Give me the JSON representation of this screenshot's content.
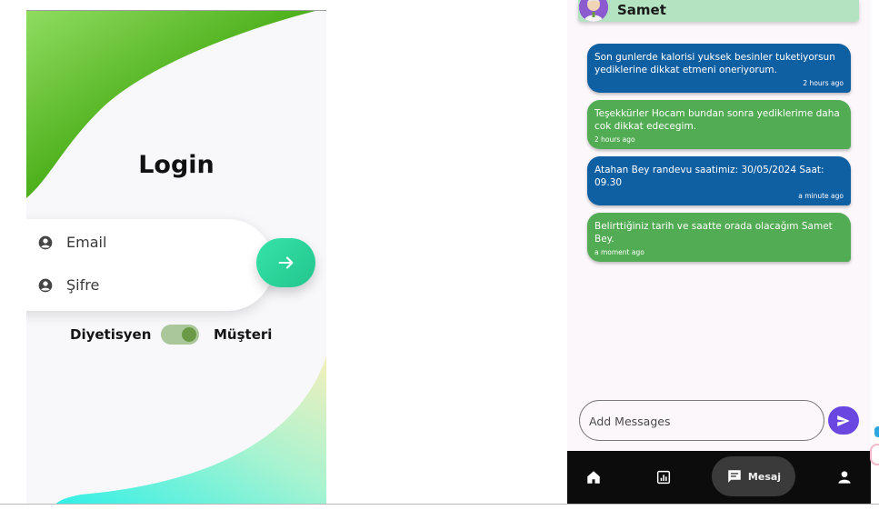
{
  "login": {
    "title": "Login",
    "email_label": "Email",
    "password_label": "Şifre",
    "toggle": {
      "left_label": "Diyetisyen",
      "right_label": "Müşteri",
      "selected": "Müşteri"
    },
    "colors": {
      "top_wave": "#4caf1a",
      "bottom_wave_start": "#3cf0e0",
      "bottom_wave_end": "#eef2c0",
      "submit_button": "#2ed89b"
    },
    "icons": {
      "email": "account-circle-icon",
      "password": "account-circle-icon",
      "submit": "arrow-right-icon"
    }
  },
  "chat": {
    "contact_name": "Samet",
    "messages": [
      {
        "text": "Son gunlerde kalorisi yuksek besinler tuketiyorsun yediklerine dikkat etmeni oneriyorum.",
        "time": "2 hours ago",
        "sender": "dietitian",
        "color": "#0f5fa3"
      },
      {
        "text": "Teşekkürler Hocam bundan sonra yediklerime daha cok dikkat edecegim.",
        "time": "2 hours ago",
        "sender": "client",
        "color": "#52ac53"
      },
      {
        "text": "Atahan Bey randevu saatimiz: 30/05/2024 Saat: 09.30",
        "time": "a minute ago",
        "sender": "dietitian",
        "color": "#0f5fa3"
      },
      {
        "text": "Belirttiğiniz tarih ve saatte orada olacağım Samet Bey.",
        "time": "a moment ago",
        "sender": "client",
        "color": "#52ac53"
      }
    ],
    "input_placeholder": "Add Messages",
    "send_color": "#6a47e0",
    "nav": {
      "home_icon": "home-icon",
      "stats_icon": "analytics-icon",
      "messages_label": "Mesaj",
      "messages_icon": "chat-icon",
      "profile_icon": "person-icon",
      "active": "Mesaj"
    }
  }
}
